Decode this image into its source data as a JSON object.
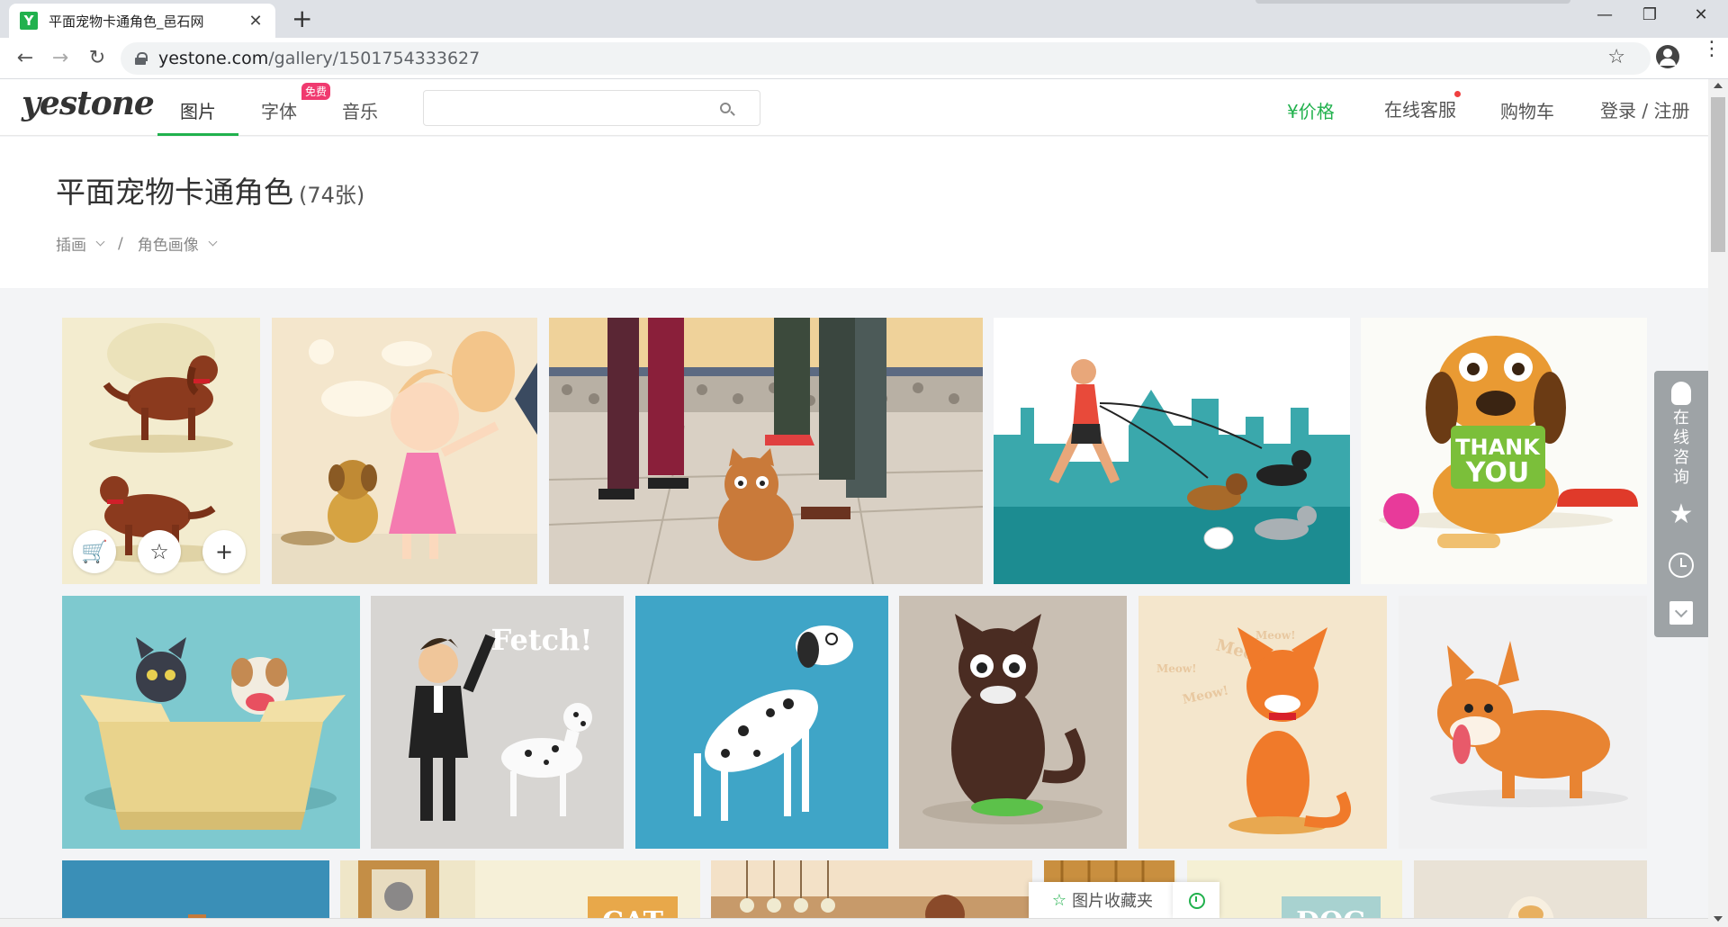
{
  "browser": {
    "favicon_letter": "Y",
    "tab_title": "平面宠物卡通角色_邑石网",
    "tab_close": "✕",
    "new_tab": "+",
    "back": "←",
    "forward": "→",
    "reload": "↻",
    "url_domain": "yestone.com",
    "url_path": "/gallery/1501754333627",
    "bookmark_icon": "☆",
    "menu_icon": "⋮",
    "minimize": "—",
    "maximize": "❐",
    "close": "✕"
  },
  "header": {
    "logo": "yestone",
    "nav": [
      "图片",
      "字体",
      "音乐"
    ],
    "free_badge": "免费",
    "search_placeholder": "",
    "price": "¥价格",
    "service": "在线客服",
    "cart": "购物车",
    "login": "登录 / 注册"
  },
  "page": {
    "title": "平面宠物卡通角色",
    "count": "(74张)",
    "breadcrumbs": [
      "插画",
      "角色画像"
    ],
    "separator": "/"
  },
  "gallery": {
    "tiles": [
      "dogs-red-setter",
      "girl-and-puppy",
      "cat-on-street-legs",
      "runner-with-dogs",
      "dog-thank-you",
      "cat-dog-in-box",
      "man-dalmatian-fetch",
      "dalmatian-blue",
      "black-cat-green-bowl",
      "orange-cat-meow",
      "corgi",
      "partial-blue",
      "partial-frame",
      "partial-cat-sign",
      "partial-cafe",
      "partial-shelf",
      "partial-dog-sign",
      "partial-bone"
    ],
    "thank_you_text": [
      "THANK",
      "YOU"
    ],
    "fetch_text": "Fetch!",
    "meow_text": [
      "Meow!",
      "Meow!",
      "Meow!",
      "Meow!"
    ],
    "cat_sign": "CAT",
    "dog_sign": "DOG",
    "actions": {
      "cart_icon": "🛒",
      "star_icon": "☆",
      "add_icon": "+"
    }
  },
  "side_panel": {
    "consult": "在线咨询",
    "star_icon": "★"
  },
  "favorites": {
    "star_icon": "☆",
    "label": "图片收藏夹"
  }
}
